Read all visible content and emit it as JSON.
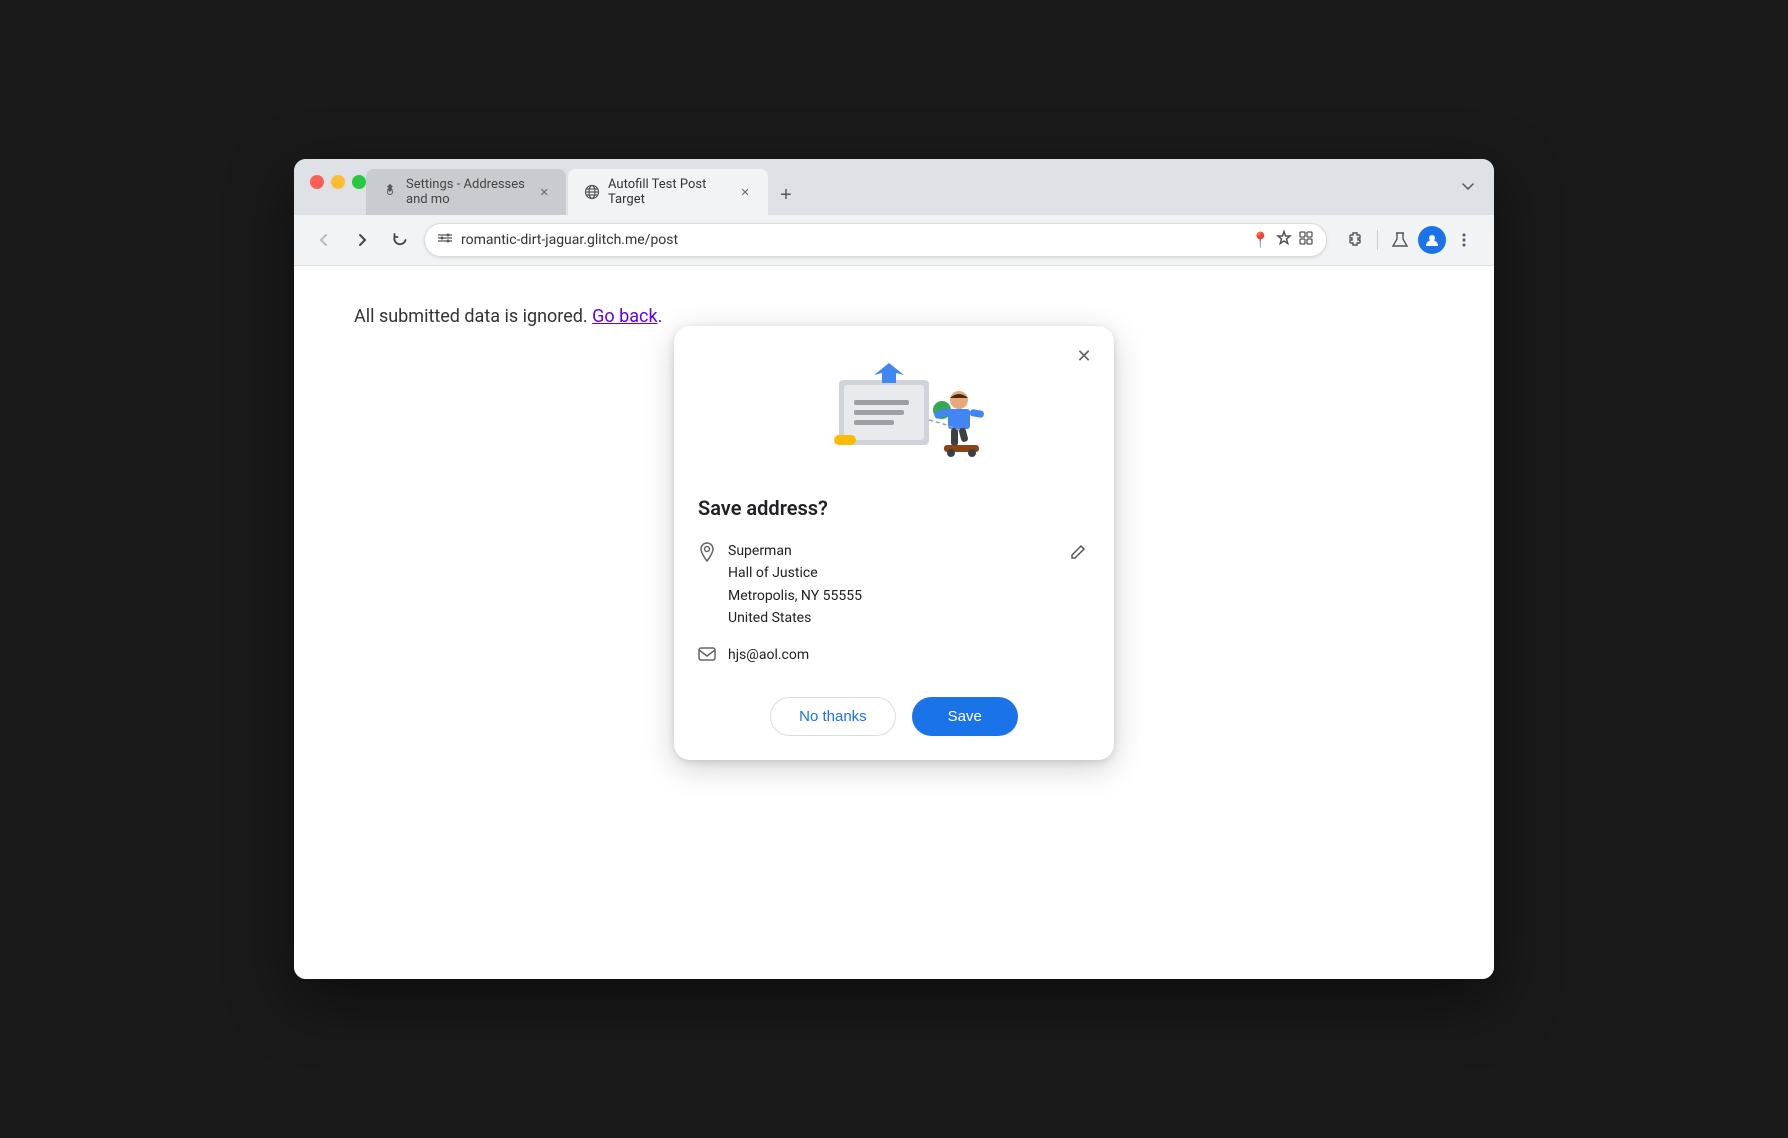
{
  "browser": {
    "tabs": [
      {
        "id": "settings-tab",
        "label": "Settings - Addresses and mo",
        "active": false,
        "icon": "gear"
      },
      {
        "id": "autofill-tab",
        "label": "Autofill Test Post Target",
        "active": true,
        "icon": "globe"
      }
    ],
    "new_tab_label": "+",
    "dropdown_label": "▾",
    "url": "romantic-dirt-jaguar.glitch.me/post",
    "nav": {
      "back_label": "←",
      "forward_label": "→",
      "reload_label": "↺"
    },
    "toolbar": {
      "extensions_label": "🧩",
      "lab_label": "🧪",
      "profile_label": "👤",
      "menu_label": "⋮"
    }
  },
  "page": {
    "content": "All submitted data is ignored.",
    "link_text": "Go back",
    "period": "."
  },
  "popup": {
    "title": "Save address?",
    "close_label": "✕",
    "address": {
      "name": "Superman",
      "line1": "Hall of Justice",
      "line2": "Metropolis, NY 55555",
      "line3": "United States"
    },
    "email": "hjs@aol.com",
    "buttons": {
      "no_thanks": "No thanks",
      "save": "Save"
    }
  },
  "colors": {
    "accent": "#1a73e8",
    "link": "#6200ea",
    "text": "#202124",
    "muted": "#666666"
  }
}
